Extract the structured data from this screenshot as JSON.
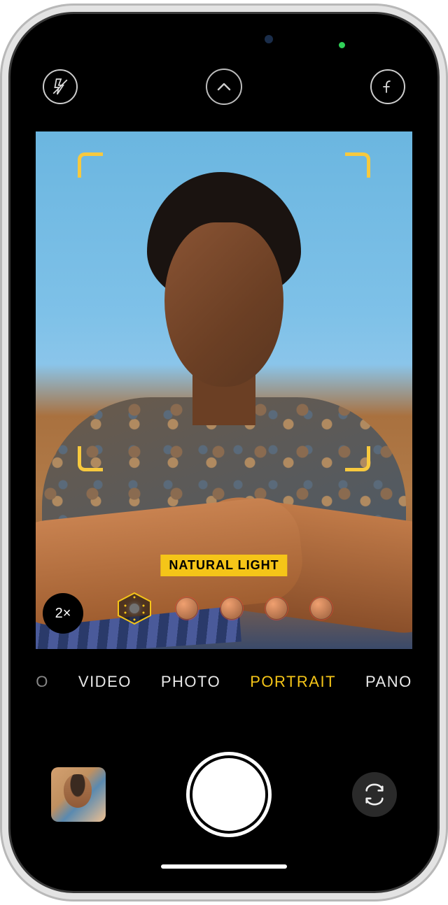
{
  "status": {
    "camera_in_use": true
  },
  "topbar": {
    "flash_icon": "flash-off-icon",
    "expand_icon": "chevron-up-icon",
    "depth_icon": "f-number-icon"
  },
  "viewfinder": {
    "lighting_label": "NATURAL LIGHT",
    "zoom": "2×",
    "lighting_options_count": 5,
    "selected_lighting_index": 0
  },
  "modes": [
    {
      "label": "O",
      "state": "edge-cut"
    },
    {
      "label": "VIDEO",
      "state": "normal"
    },
    {
      "label": "PHOTO",
      "state": "normal"
    },
    {
      "label": "PORTRAIT",
      "state": "active"
    },
    {
      "label": "PANO",
      "state": "normal"
    }
  ],
  "bottom": {
    "thumbnail_desc": "last-photo-thumbnail",
    "shutter_desc": "shutter-button",
    "flip_desc": "camera-flip-button"
  }
}
